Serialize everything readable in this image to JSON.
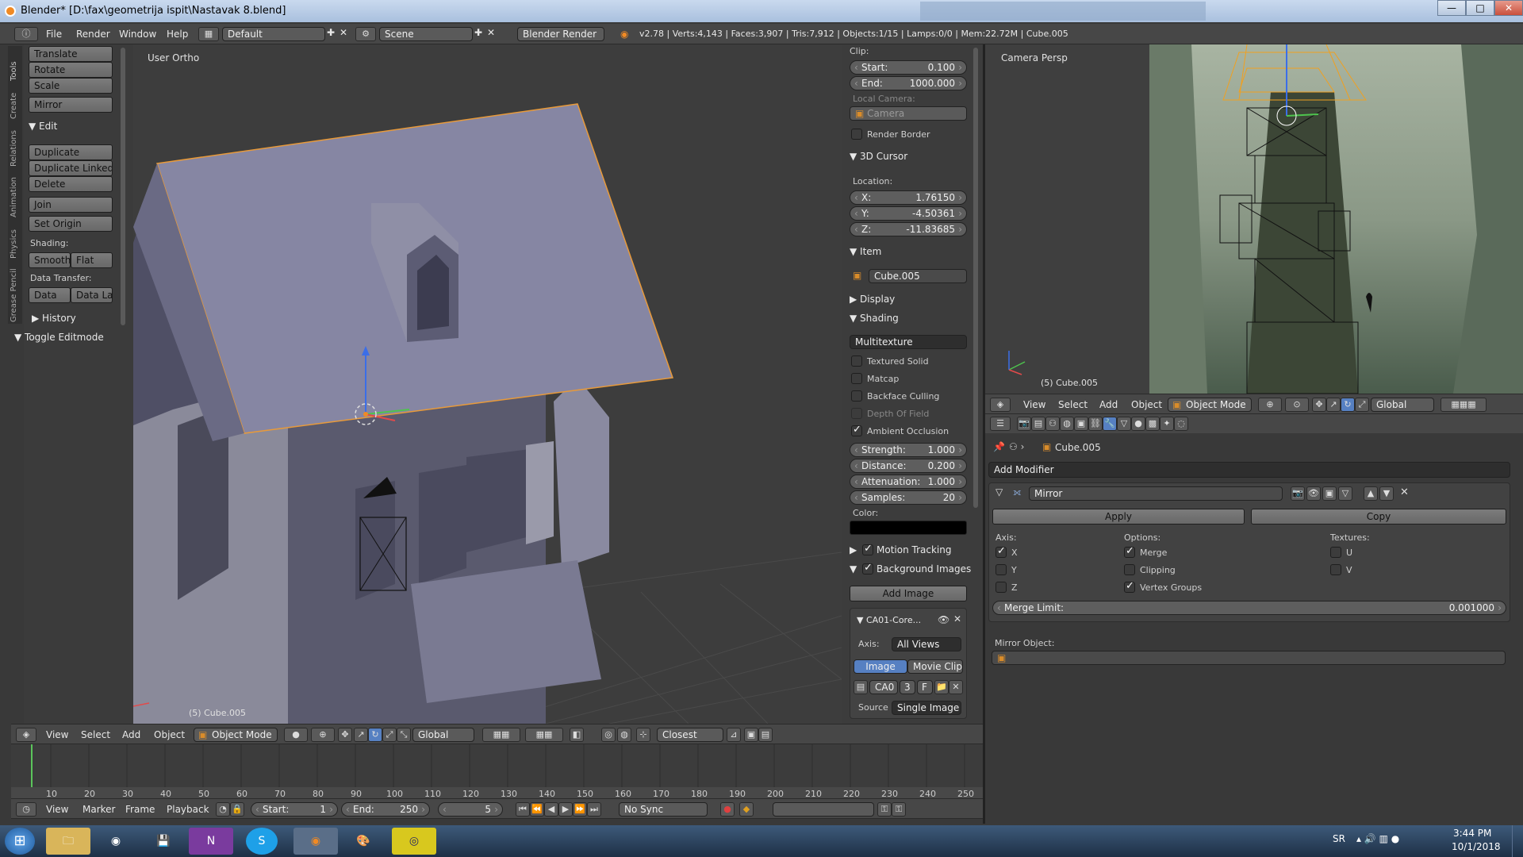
{
  "window": {
    "title": "Blender* [D:\\fax\\geometrija ispit\\Nastavak 8.blend]",
    "minimize": "—",
    "maximize": "□",
    "close": "✕"
  },
  "topbar": {
    "menus": [
      "File",
      "Render",
      "Window",
      "Help"
    ],
    "layout": "Default",
    "scene": "Scene",
    "engine": "Blender Render",
    "stats": "v2.78 | Verts:4,143 | Faces:3,907 | Tris:7,912 | Objects:1/15 | Lamps:0/0 | Mem:22.72M | Cube.005"
  },
  "tabs": [
    "Tools",
    "Create",
    "Relations",
    "Animation",
    "Physics",
    "Grease Pencil"
  ],
  "toolshelf": {
    "transform": [
      "Translate",
      "Rotate",
      "Scale"
    ],
    "mirror": "Mirror",
    "edit_title": "Edit",
    "edit": [
      "Duplicate",
      "Duplicate Linked",
      "Delete"
    ],
    "join": "Join",
    "set_origin": "Set Origin",
    "shading_label": "Shading:",
    "smooth": "Smooth",
    "flat": "Flat",
    "data_transfer_label": "Data Transfer:",
    "data": "Data",
    "data_la": "Data La",
    "history": "History",
    "toggle_editmode": "Toggle Editmode"
  },
  "viewport": {
    "label": "User Ortho",
    "object": "(5) Cube.005"
  },
  "npanel": {
    "clip_label": "Clip:",
    "start_label": "Start:",
    "start": "0.100",
    "end_label": "End:",
    "end": "1000.000",
    "local_camera_label": "Local Camera:",
    "camera": "Camera",
    "render_border": "Render Border",
    "cursor_title": "3D Cursor",
    "location_label": "Location:",
    "x_label": "X:",
    "x": "1.76150",
    "y_label": "Y:",
    "y": "-4.50361",
    "z_label": "Z:",
    "z": "-11.83685",
    "item_title": "Item",
    "item_name": "Cube.005",
    "display_title": "Display",
    "shading_title": "Shading",
    "shading_mode": "Multitexture",
    "textured_solid": "Textured Solid",
    "matcap": "Matcap",
    "backface_culling": "Backface Culling",
    "depth_of_field": "Depth Of Field",
    "ambient_occlusion": "Ambient Occlusion",
    "strength_label": "Strength:",
    "strength": "1.000",
    "distance_label": "Distance:",
    "distance": "0.200",
    "attenuation_label": "Attenuation:",
    "attenuation": "1.000",
    "samples_label": "Samples:",
    "samples": "20",
    "color_label": "Color:",
    "motion_tracking": "Motion Tracking",
    "background_images": "Background Images",
    "add_image": "Add Image",
    "bg_name": "CA01-Core...",
    "axis_label": "Axis:",
    "axis_value": "All Views",
    "image_tab": "Image",
    "movieclip_tab": "Movie Clip",
    "img_short": "CA0",
    "img_users": "3",
    "img_f": "F",
    "source_label": "Source",
    "source_value": "Single Image"
  },
  "bottom_header": {
    "menus": [
      "View",
      "Select",
      "Add",
      "Object"
    ],
    "mode": "Object Mode",
    "orientation": "Global",
    "snap": "Closest"
  },
  "timeline": {
    "ticks": [
      "10",
      "20",
      "30",
      "40",
      "50",
      "60",
      "70",
      "80",
      "90",
      "100",
      "110",
      "120",
      "130",
      "140",
      "150",
      "160",
      "170",
      "180",
      "190",
      "200",
      "210",
      "220",
      "230",
      "240",
      "250"
    ],
    "menus": [
      "View",
      "Marker",
      "Frame",
      "Playback"
    ],
    "start_label": "Start:",
    "start": "1",
    "end_label": "End:",
    "end": "250",
    "current": "5",
    "sync": "No Sync"
  },
  "camera_view": {
    "label": "Camera Persp",
    "object": "(5) Cube.005",
    "menus": [
      "View",
      "Select",
      "Add",
      "Object"
    ],
    "mode": "Object Mode",
    "orientation": "Global"
  },
  "properties": {
    "breadcrumb": "Cube.005",
    "add_modifier": "Add Modifier",
    "modifier_name": "Mirror",
    "apply": "Apply",
    "copy": "Copy",
    "axis_label": "Axis:",
    "options_label": "Options:",
    "textures_label": "Textures:",
    "ax_x": "X",
    "ax_y": "Y",
    "ax_z": "Z",
    "merge": "Merge",
    "clipping": "Clipping",
    "vertex_groups": "Vertex Groups",
    "tex_u": "U",
    "tex_v": "V",
    "merge_limit_label": "Merge Limit:",
    "merge_limit": "0.001000",
    "mirror_object_label": "Mirror Object:"
  },
  "taskbar": {
    "lang": "SR",
    "time": "3:44 PM",
    "date": "10/1/2018"
  }
}
